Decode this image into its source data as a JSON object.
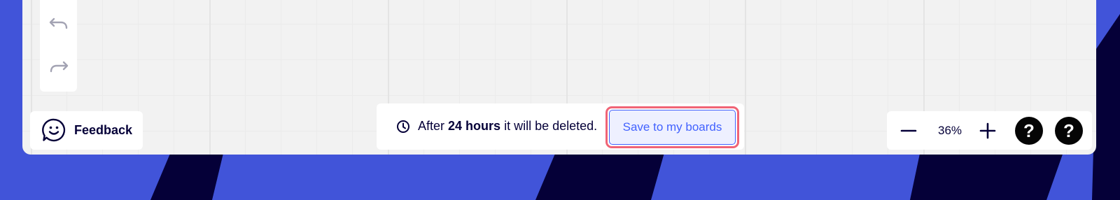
{
  "colors": {
    "background": "#4154d9",
    "stripe": "#050038",
    "board": "#f2f2f2",
    "accent": "#4262ff",
    "highlight": "#f06476",
    "text": "#050038"
  },
  "toolbar": {
    "undo_icon": "undo-icon",
    "redo_icon": "redo-icon"
  },
  "feedback": {
    "icon": "smiley-chat-icon",
    "label": "Feedback"
  },
  "notice": {
    "icon": "clock-icon",
    "text_before": "After",
    "text_bold": "24 hours",
    "text_after": "it will be deleted.",
    "save_label": "Save to my boards"
  },
  "zoom": {
    "out_icon": "minus-icon",
    "value": "36%",
    "in_icon": "plus-icon",
    "help_label_1": "?",
    "help_label_2": "?"
  }
}
